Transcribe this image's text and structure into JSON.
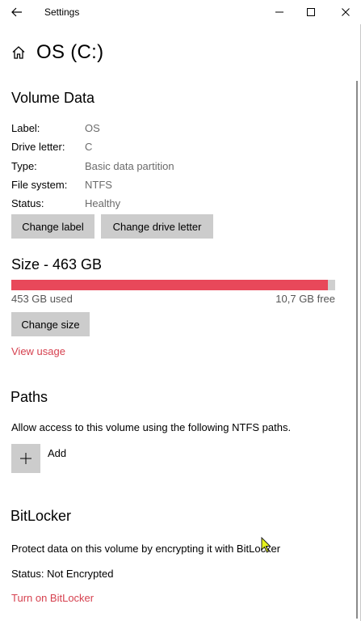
{
  "window": {
    "title": "Settings",
    "back_icon": "arrow-left-icon",
    "controls": [
      "minimize-icon",
      "maximize-icon",
      "close-icon"
    ]
  },
  "header": {
    "icon": "home-icon",
    "title": "OS (C:)"
  },
  "volume": {
    "title": "Volume Data",
    "properties": [
      {
        "label": "Label:",
        "value": "OS"
      },
      {
        "label": "Drive letter:",
        "value": "C"
      },
      {
        "label": "Type:",
        "value": "Basic data partition"
      },
      {
        "label": "File system:",
        "value": "NTFS"
      },
      {
        "label": "Status:",
        "value": "Healthy"
      }
    ],
    "change_label_button": "Change label",
    "change_letter_button": "Change drive letter"
  },
  "size": {
    "title": "Size - 463 GB",
    "used_text": "453 GB used",
    "free_text": "10,7 GB free",
    "used_fraction": 0.977,
    "bar_color": "#e8485a",
    "change_size_button": "Change size",
    "view_usage_link": "View usage"
  },
  "paths": {
    "title": "Paths",
    "description": "Allow access to this volume using the following NTFS paths.",
    "add_label": "Add",
    "add_icon": "plus-icon"
  },
  "bitlocker": {
    "title": "BitLocker",
    "description": "Protect data on this volume by encrypting it with BitLocker",
    "status": "Status: Not Encrypted",
    "turn_on_link": "Turn on BitLocker"
  },
  "colors": {
    "accent_link": "#d6414f",
    "button_bg": "#cccccc"
  }
}
